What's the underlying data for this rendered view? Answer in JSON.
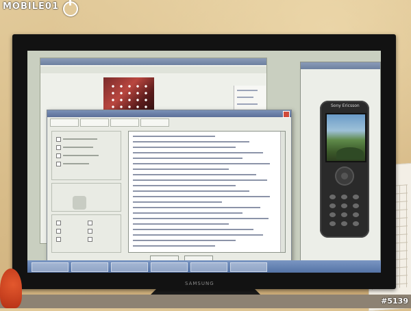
{
  "watermark": {
    "brand": "MOBILE01",
    "photo_tag": "#5139"
  },
  "monitor": {
    "bottom_brand": "SAMSUNG"
  },
  "phone": {
    "brand": "Sony Ericsson"
  },
  "colors": {
    "wall": "#d7bb88",
    "bezel": "#121212",
    "titlebar": "#6d80a0",
    "dialog_bg": "#e9ebe4",
    "taskbar": "#5573a6",
    "phone_body": "#2a2a2a"
  }
}
